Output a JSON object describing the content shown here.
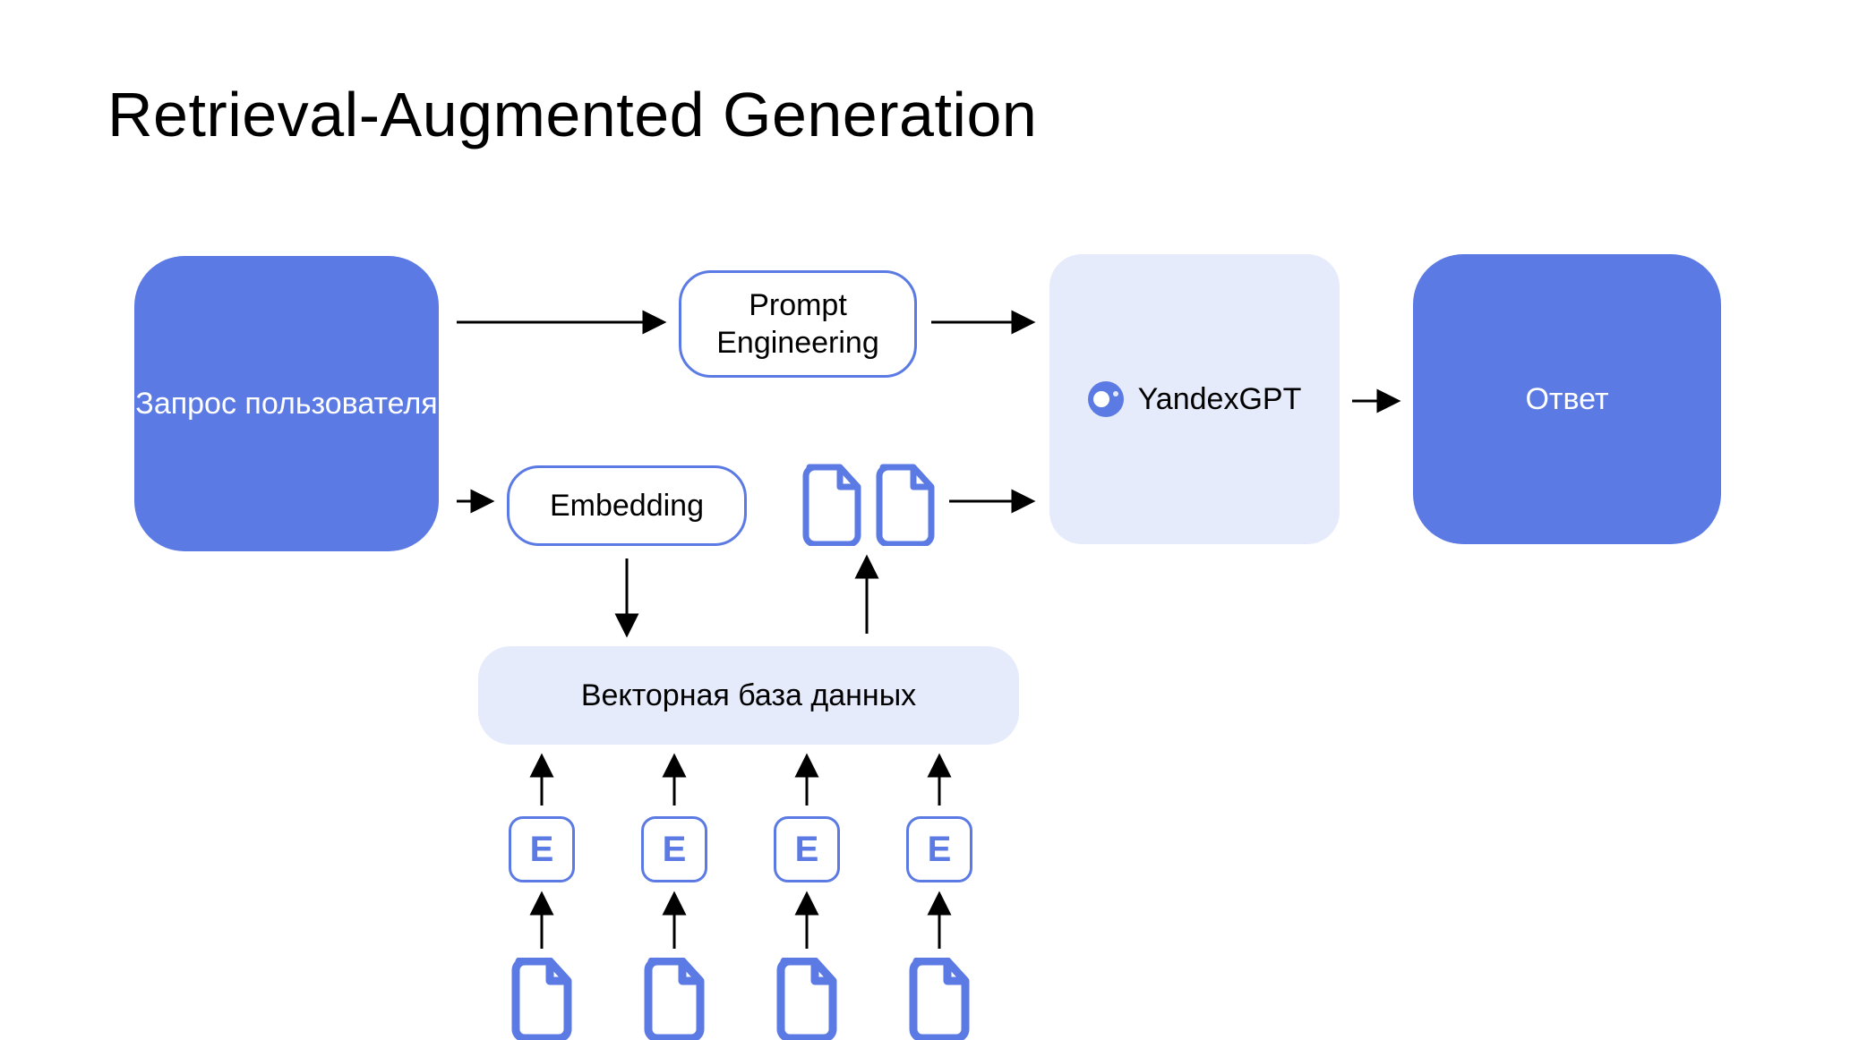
{
  "title": "Retrieval-Augmented Generation",
  "nodes": {
    "user_query": "Запрос пользователя",
    "prompt_eng": "Prompt Engineering",
    "embedding": "Embedding",
    "vector_db": "Векторная база данных",
    "yandexgpt": "YandexGPT",
    "answer": "Ответ"
  },
  "e_tokens": [
    "E",
    "E",
    "E",
    "E"
  ],
  "colors": {
    "primary": "#5b7ae4",
    "tint": "#e6ebfb"
  }
}
